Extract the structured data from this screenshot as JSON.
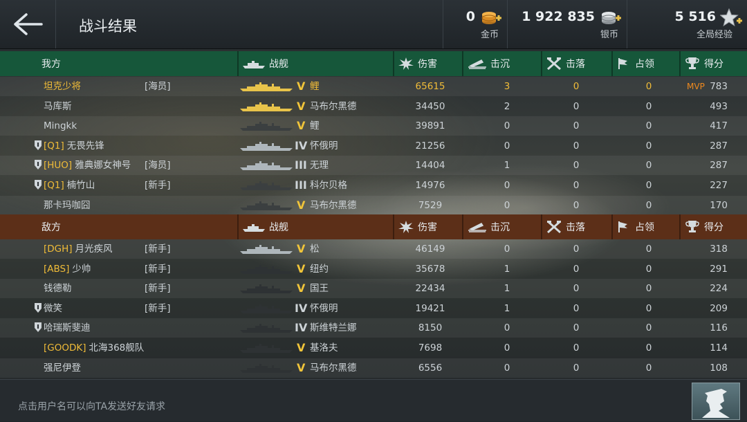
{
  "header": {
    "title": "战斗结果",
    "gold": {
      "value": "0",
      "label": "金币"
    },
    "silver": {
      "value": "1 922 835",
      "label": "银币"
    },
    "xp": {
      "value": "5 516",
      "label": "全局经验"
    }
  },
  "columns": {
    "ship": "战舰",
    "damage": "伤害",
    "sunk": "击沉",
    "downed": "击落",
    "capture": "占领",
    "score": "得分"
  },
  "ally": {
    "label": "我方",
    "players": [
      {
        "clan": "",
        "name": "坦克少将",
        "tag": "[海员]",
        "tier": "V",
        "ship": "鲤",
        "damage": "65615",
        "sunk": "3",
        "downed": "0",
        "capture": "0",
        "mvp": "MVP",
        "score": "783"
      },
      {
        "clan": "",
        "name": "马库斯",
        "tag": "",
        "tier": "V",
        "ship": "马布尔黑德",
        "damage": "34450",
        "sunk": "2",
        "downed": "0",
        "capture": "0",
        "mvp": "",
        "score": "493"
      },
      {
        "clan": "",
        "name": "Mingkk",
        "tag": "",
        "tier": "V",
        "ship": "鲤",
        "damage": "39891",
        "sunk": "0",
        "downed": "0",
        "capture": "0",
        "mvp": "",
        "score": "417"
      },
      {
        "clan": "[Q1]",
        "name": "无畏先锋",
        "tag": "",
        "tier": "IV",
        "ship": "怀俄明",
        "damage": "21256",
        "sunk": "0",
        "downed": "0",
        "capture": "0",
        "mvp": "",
        "score": "287"
      },
      {
        "clan": "[HUO]",
        "name": "雅典娜女神号",
        "tag": "[海员]",
        "tier": "III",
        "ship": "无理",
        "damage": "14404",
        "sunk": "1",
        "downed": "0",
        "capture": "0",
        "mvp": "",
        "score": "287"
      },
      {
        "clan": "[Q1]",
        "name": "楠竹山",
        "tag": "[新手]",
        "tier": "III",
        "ship": "科尔贝格",
        "damage": "14976",
        "sunk": "0",
        "downed": "0",
        "capture": "0",
        "mvp": "",
        "score": "227"
      },
      {
        "clan": "",
        "name": "那卡玛咖囧",
        "tag": "",
        "tier": "V",
        "ship": "马布尔黑德",
        "damage": "7529",
        "sunk": "0",
        "downed": "0",
        "capture": "0",
        "mvp": "",
        "score": "170"
      }
    ]
  },
  "enemy": {
    "label": "敌方",
    "players": [
      {
        "clan": "[DGH]",
        "name": "月光疾风",
        "tag": "[新手]",
        "tier": "V",
        "ship": "松",
        "damage": "46149",
        "sunk": "0",
        "downed": "0",
        "capture": "0",
        "score": "318"
      },
      {
        "clan": "[ABS]",
        "name": "少帅",
        "tag": "[新手]",
        "tier": "V",
        "ship": "纽约",
        "damage": "35678",
        "sunk": "1",
        "downed": "0",
        "capture": "0",
        "score": "291"
      },
      {
        "clan": "",
        "name": "钱德勒",
        "tag": "[新手]",
        "tier": "V",
        "ship": "国王",
        "damage": "22434",
        "sunk": "1",
        "downed": "0",
        "capture": "0",
        "score": "224"
      },
      {
        "clan": "",
        "name": "微笑",
        "tag": "[新手]",
        "tier": "IV",
        "ship": "怀俄明",
        "damage": "19421",
        "sunk": "1",
        "downed": "0",
        "capture": "0",
        "score": "209"
      },
      {
        "clan": "",
        "name": "哈瑞斯斐迪",
        "tag": "",
        "tier": "IV",
        "ship": "斯维特兰娜",
        "damage": "8150",
        "sunk": "0",
        "downed": "0",
        "capture": "0",
        "score": "116"
      },
      {
        "clan": "[GOODK]",
        "name": "北海368舰队",
        "tag": "",
        "tier": "V",
        "ship": "基洛夫",
        "damage": "7698",
        "sunk": "0",
        "downed": "0",
        "capture": "0",
        "score": "114"
      },
      {
        "clan": "",
        "name": "强尼伊登",
        "tag": "",
        "tier": "V",
        "ship": "马布尔黑德",
        "damage": "6556",
        "sunk": "0",
        "downed": "0",
        "capture": "0",
        "score": "108"
      }
    ]
  },
  "footer": {
    "hint": "点击用户名可以向TA发送好友请求"
  }
}
